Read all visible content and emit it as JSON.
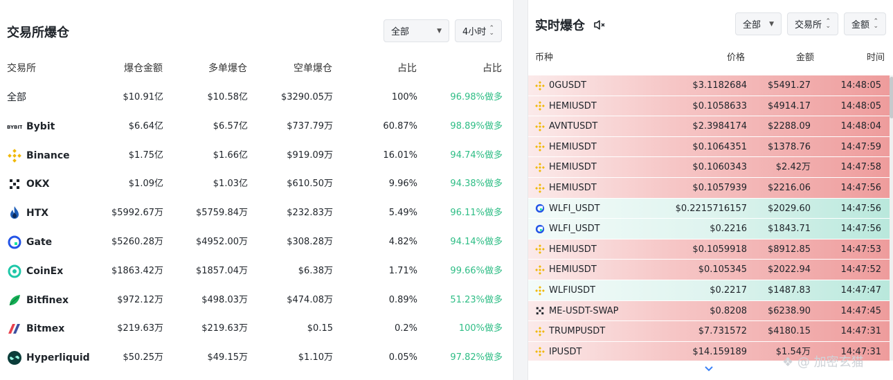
{
  "left": {
    "title": "交易所爆仓",
    "filter": {
      "value": "全部"
    },
    "period": {
      "value": "4小时"
    },
    "headers": [
      "交易所",
      "爆仓金额",
      "多单爆仓",
      "空单爆仓",
      "占比",
      "占比"
    ],
    "rows": [
      {
        "name": "全部",
        "icon": "none",
        "total": "$10.91亿",
        "long": "$10.58亿",
        "short": "$3290.05万",
        "share": "100%",
        "ratio": "96.98%做多"
      },
      {
        "name": "Bybit",
        "icon": "bybit-logo",
        "total": "$6.64亿",
        "long": "$6.57亿",
        "short": "$737.79万",
        "share": "60.87%",
        "ratio": "98.89%做多"
      },
      {
        "name": "Binance",
        "icon": "binance-logo",
        "total": "$1.75亿",
        "long": "$1.66亿",
        "short": "$919.09万",
        "share": "16.01%",
        "ratio": "94.74%做多"
      },
      {
        "name": "OKX",
        "icon": "okx-logo",
        "total": "$1.09亿",
        "long": "$1.03亿",
        "short": "$610.50万",
        "share": "9.96%",
        "ratio": "94.38%做多"
      },
      {
        "name": "HTX",
        "icon": "htx-logo",
        "total": "$5992.67万",
        "long": "$5759.84万",
        "short": "$232.83万",
        "share": "5.49%",
        "ratio": "96.11%做多"
      },
      {
        "name": "Gate",
        "icon": "gate-logo",
        "total": "$5260.28万",
        "long": "$4952.00万",
        "short": "$308.28万",
        "share": "4.82%",
        "ratio": "94.14%做多"
      },
      {
        "name": "CoinEx",
        "icon": "coinex-logo",
        "total": "$1863.42万",
        "long": "$1857.04万",
        "short": "$6.38万",
        "share": "1.71%",
        "ratio": "99.66%做多"
      },
      {
        "name": "Bitfinex",
        "icon": "bitfinex-logo",
        "total": "$972.12万",
        "long": "$498.03万",
        "short": "$474.08万",
        "share": "0.89%",
        "ratio": "51.23%做多"
      },
      {
        "name": "Bitmex",
        "icon": "bitmex-logo",
        "total": "$219.63万",
        "long": "$219.63万",
        "short": "$0.15",
        "share": "0.2%",
        "ratio": "100%做多"
      },
      {
        "name": "Hyperliquid",
        "icon": "hyperliquid-logo",
        "total": "$50.25万",
        "long": "$49.15万",
        "short": "$1.10万",
        "share": "0.05%",
        "ratio": "97.82%做多"
      }
    ]
  },
  "right": {
    "title": "实时爆仓",
    "mute_icon": "speaker-mute-icon",
    "filter_all": "全部",
    "filter_exchange": "交易所",
    "filter_amount": "金额",
    "headers": {
      "symbol": "币种",
      "price": "价格",
      "amount": "金额",
      "time": "时间"
    },
    "rows": [
      {
        "symbol": "0GUSDT",
        "icon": "binance",
        "side": "sell",
        "price": "$3.1182684",
        "amount": "$5491.27",
        "time": "14:48:05"
      },
      {
        "symbol": "HEMIUSDT",
        "icon": "binance",
        "side": "sell",
        "price": "$0.1058633",
        "amount": "$4914.17",
        "time": "14:48:05"
      },
      {
        "symbol": "AVNTUSDT",
        "icon": "binance",
        "side": "sell",
        "price": "$2.3984174",
        "amount": "$2288.09",
        "time": "14:48:04"
      },
      {
        "symbol": "HEMIUSDT",
        "icon": "binance",
        "side": "sell",
        "price": "$0.1064351",
        "amount": "$1378.76",
        "time": "14:47:59"
      },
      {
        "symbol": "HEMIUSDT",
        "icon": "binance",
        "side": "sell",
        "price": "$0.1060343",
        "amount": "$2.42万",
        "time": "14:47:58"
      },
      {
        "symbol": "HEMIUSDT",
        "icon": "binance",
        "side": "sell",
        "price": "$0.1057939",
        "amount": "$2216.06",
        "time": "14:47:56"
      },
      {
        "symbol": "WLFI_USDT",
        "icon": "gate",
        "side": "buy",
        "price": "$0.2215716157",
        "amount": "$2029.60",
        "time": "14:47:56"
      },
      {
        "symbol": "WLFI_USDT",
        "icon": "gate",
        "side": "buy",
        "price": "$0.2216",
        "amount": "$1843.71",
        "time": "14:47:56"
      },
      {
        "symbol": "HEMIUSDT",
        "icon": "binance",
        "side": "sell",
        "price": "$0.1059918",
        "amount": "$8912.85",
        "time": "14:47:53"
      },
      {
        "symbol": "HEMIUSDT",
        "icon": "binance",
        "side": "sell",
        "price": "$0.105345",
        "amount": "$2022.94",
        "time": "14:47:52"
      },
      {
        "symbol": "WLFIUSDT",
        "icon": "binance",
        "side": "buy",
        "price": "$0.2217",
        "amount": "$1487.83",
        "time": "14:47:47"
      },
      {
        "symbol": "ME-USDT-SWAP",
        "icon": "okx",
        "side": "sell",
        "price": "$0.8208",
        "amount": "$6238.90",
        "time": "14:47:45"
      },
      {
        "symbol": "TRUMPUSDT",
        "icon": "binance",
        "side": "sell",
        "price": "$7.731572",
        "amount": "$4180.15",
        "time": "14:47:31"
      },
      {
        "symbol": "IPUSDT",
        "icon": "binance",
        "side": "sell",
        "price": "$14.159189",
        "amount": "$1.54万",
        "time": "14:47:31"
      }
    ]
  },
  "watermark": "加密玄猫",
  "colors": {
    "long_green": "#2ebd85",
    "binance_yellow": "#f0b90b",
    "gate_blue": "#2354e6",
    "sell_red": "#ee9c9c",
    "buy_green": "#b9e8dc"
  }
}
